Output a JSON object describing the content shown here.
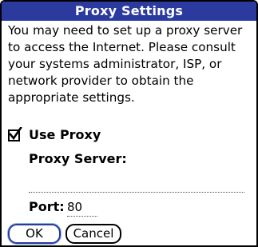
{
  "dialog": {
    "title": "Proxy Settings",
    "message": "You may need to set up a proxy server to access the Internet. Please consult your systems administrator, ISP, or network provider to obtain the appropriate settings."
  },
  "use_proxy": {
    "label": "Use Proxy",
    "checked": true
  },
  "proxy_server": {
    "label": "Proxy Server:",
    "value": ""
  },
  "port": {
    "label": "Port:",
    "value": "80"
  },
  "buttons": {
    "ok": "OK",
    "cancel": "Cancel"
  },
  "colors": {
    "title_bar": "#2b3a9e",
    "title_text": "#ffffff",
    "focus_ring": "#8fb3e8"
  }
}
